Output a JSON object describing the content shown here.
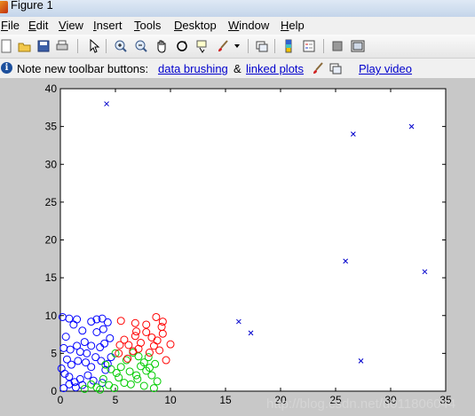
{
  "window": {
    "title": "Figure 1"
  },
  "menu": [
    {
      "name": "file",
      "first": "F",
      "rest": "ile"
    },
    {
      "name": "edit",
      "first": "E",
      "rest": "dit"
    },
    {
      "name": "view",
      "first": "V",
      "rest": "iew"
    },
    {
      "name": "insert",
      "first": "I",
      "rest": "nsert"
    },
    {
      "name": "tools",
      "first": "T",
      "rest": "ools"
    },
    {
      "name": "desktop",
      "first": "D",
      "rest": "esktop"
    },
    {
      "name": "window",
      "first": "W",
      "rest": "indow"
    },
    {
      "name": "help",
      "first": "H",
      "rest": "elp"
    }
  ],
  "toolbar_icons": [
    "new-figure-icon",
    "open-file-icon",
    "save-icon",
    "print-icon",
    "pointer-icon",
    "zoom-in-icon",
    "zoom-out-icon",
    "pan-icon",
    "rotate-3d-icon",
    "data-cursor-icon",
    "brush-icon",
    "brush-dropdown-icon",
    "link-plot-icon",
    "colorbar-icon",
    "legend-icon",
    "hide-plot-tools-icon",
    "show-plot-tools-icon"
  ],
  "infobar": {
    "note": "Note new toolbar buttons:",
    "link1": "data brushing",
    "amp": "&",
    "link2": "linked plots",
    "video": "Play video"
  },
  "watermark": "http://blog.csdn.net/u011806044",
  "chart_data": {
    "type": "scatter",
    "xlim": [
      0,
      35
    ],
    "ylim": [
      0,
      40
    ],
    "xticks": [
      0,
      5,
      10,
      15,
      20,
      25,
      30,
      35
    ],
    "yticks": [
      0,
      5,
      10,
      15,
      20,
      25,
      30,
      35,
      40
    ],
    "grid": false,
    "series": [
      {
        "marker": "o",
        "color": "#0000ff",
        "points": [
          [
            0.2,
            9.8
          ],
          [
            0.8,
            9.6
          ],
          [
            1.5,
            9.5
          ],
          [
            0.5,
            7.2
          ],
          [
            1.2,
            8.8
          ],
          [
            2.0,
            8.0
          ],
          [
            2.8,
            9.2
          ],
          [
            3.3,
            9.5
          ],
          [
            3.8,
            9.6
          ],
          [
            4.3,
            9.1
          ],
          [
            0.3,
            5.7
          ],
          [
            0.9,
            5.5
          ],
          [
            1.5,
            6.0
          ],
          [
            1.8,
            5.2
          ],
          [
            2.2,
            6.5
          ],
          [
            2.8,
            6.0
          ],
          [
            3.3,
            7.8
          ],
          [
            3.6,
            5.8
          ],
          [
            4.0,
            6.3
          ],
          [
            0.6,
            4.2
          ],
          [
            1.0,
            3.5
          ],
          [
            1.6,
            4.0
          ],
          [
            2.3,
            3.8
          ],
          [
            2.8,
            3.2
          ],
          [
            3.2,
            4.5
          ],
          [
            3.7,
            4.0
          ],
          [
            4.3,
            3.6
          ],
          [
            0.4,
            2.3
          ],
          [
            0.8,
            1.9
          ],
          [
            1.3,
            1.2
          ],
          [
            1.8,
            1.6
          ],
          [
            2.5,
            2.1
          ],
          [
            3.0,
            1.4
          ],
          [
            3.8,
            1.1
          ],
          [
            4.1,
            2.8
          ],
          [
            0.3,
            0.4
          ],
          [
            0.8,
            0.9
          ],
          [
            1.4,
            0.5
          ],
          [
            2.0,
            0.8
          ],
          [
            0.1,
            3.0
          ],
          [
            2.4,
            5.0
          ],
          [
            3.9,
            8.2
          ],
          [
            4.5,
            7.0
          ],
          [
            4.6,
            4.5
          ]
        ]
      },
      {
        "marker": "o",
        "color": "#00cc00",
        "points": [
          [
            2.2,
            0.3
          ],
          [
            2.8,
            0.9
          ],
          [
            3.3,
            0.5
          ],
          [
            3.9,
            1.6
          ],
          [
            4.4,
            0.8
          ],
          [
            4.9,
            0.4
          ],
          [
            5.3,
            1.8
          ],
          [
            5.8,
            1.1
          ],
          [
            6.3,
            2.6
          ],
          [
            6.9,
            2.1
          ],
          [
            7.3,
            3.3
          ],
          [
            7.8,
            2.7
          ],
          [
            8.3,
            2.1
          ],
          [
            8.8,
            1.3
          ],
          [
            8.5,
            0.4
          ],
          [
            7.6,
            0.7
          ],
          [
            6.4,
            0.9
          ],
          [
            5.5,
            3.2
          ],
          [
            6.0,
            4.1
          ],
          [
            6.6,
            5.1
          ],
          [
            7.1,
            4.6
          ],
          [
            7.6,
            3.8
          ],
          [
            8.1,
            3.1
          ],
          [
            8.6,
            3.6
          ],
          [
            5.1,
            2.4
          ],
          [
            4.6,
            2.9
          ],
          [
            3.6,
            0.2
          ],
          [
            7.0,
            1.6
          ],
          [
            5.0,
            5.0
          ],
          [
            8.0,
            4.5
          ],
          [
            4.1,
            3.5
          ]
        ]
      },
      {
        "marker": "o",
        "color": "#ff0000",
        "points": [
          [
            5.5,
            9.3
          ],
          [
            6.8,
            9.0
          ],
          [
            7.8,
            8.8
          ],
          [
            8.7,
            9.8
          ],
          [
            9.3,
            9.2
          ],
          [
            5.8,
            6.8
          ],
          [
            6.2,
            6.1
          ],
          [
            6.8,
            7.3
          ],
          [
            7.3,
            6.4
          ],
          [
            7.8,
            7.8
          ],
          [
            8.3,
            7.1
          ],
          [
            8.8,
            6.7
          ],
          [
            9.3,
            7.6
          ],
          [
            5.4,
            6.1
          ],
          [
            6.6,
            5.3
          ],
          [
            7.1,
            5.6
          ],
          [
            8.1,
            5.1
          ],
          [
            9.0,
            5.4
          ],
          [
            9.6,
            4.1
          ],
          [
            10.0,
            6.2
          ],
          [
            6.1,
            4.3
          ],
          [
            6.9,
            7.9
          ],
          [
            8.5,
            6.0
          ],
          [
            5.3,
            5.0
          ],
          [
            9.2,
            8.5
          ]
        ]
      },
      {
        "marker": "x",
        "color": "#0000cc",
        "points": [
          [
            4.2,
            38.0
          ],
          [
            26.6,
            34.0
          ],
          [
            31.9,
            35.0
          ],
          [
            25.9,
            17.2
          ],
          [
            33.1,
            15.8
          ],
          [
            16.2,
            9.2
          ],
          [
            17.3,
            7.7
          ],
          [
            27.3,
            4.0
          ]
        ]
      }
    ]
  }
}
